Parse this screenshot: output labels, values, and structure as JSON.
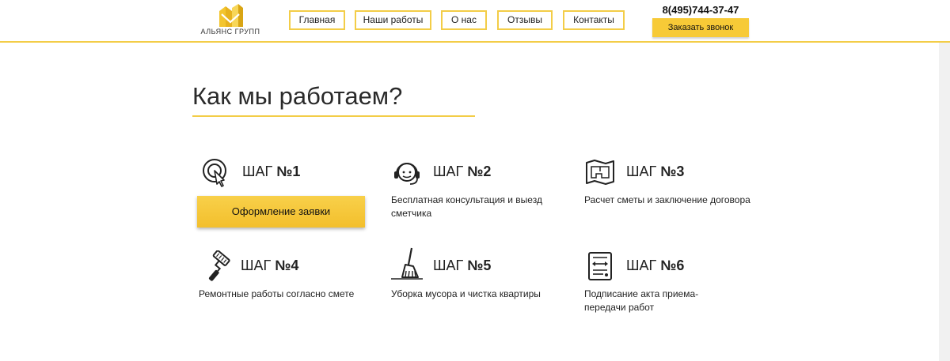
{
  "brand": {
    "name": "АЛЬЯНС ГРУПП",
    "accent": "#f3cd47",
    "button": "#f7ca37"
  },
  "nav": {
    "items": [
      {
        "label": "Главная"
      },
      {
        "label": "Наши работы"
      },
      {
        "label": "О нас"
      },
      {
        "label": "Отзывы"
      },
      {
        "label": "Контакты"
      }
    ]
  },
  "contact": {
    "phone": "8(495)744-37-47",
    "callback_label": "Заказать звонок"
  },
  "section": {
    "title": "Как мы работаем?"
  },
  "steps": [
    {
      "label": "ШАГ",
      "number": "№1",
      "icon": "target-click-icon",
      "button_label": "Оформление заявки"
    },
    {
      "label": "ШАГ",
      "number": "№2",
      "icon": "headset-operator-icon",
      "text": "Бесплатная консультация и выезд сметчика"
    },
    {
      "label": "ШАГ",
      "number": "№3",
      "icon": "blueprint-map-icon",
      "text": "Расчет сметы и заключение договора"
    },
    {
      "label": "ШАГ",
      "number": "№4",
      "icon": "paint-roller-icon",
      "text": "Ремонтные работы согласно смете"
    },
    {
      "label": "ШАГ",
      "number": "№5",
      "icon": "broom-icon",
      "text": "Уборка мусора и чистка квартиры"
    },
    {
      "label": "ШАГ",
      "number": "№6",
      "icon": "document-signing-icon",
      "text": "Подписание акта приема-передачи работ"
    }
  ]
}
